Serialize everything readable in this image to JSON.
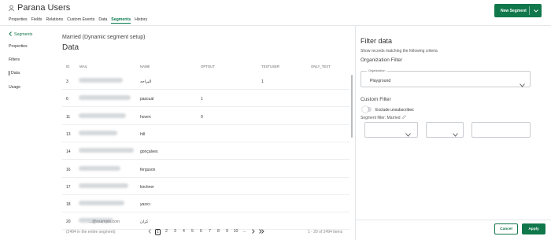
{
  "header": {
    "title": "Parana Users",
    "tabs": [
      "Properties",
      "Fields",
      "Relations",
      "Custom Events",
      "Data",
      "Segments",
      "History"
    ],
    "active_tab": "Segments",
    "new_segment_label": "New Segment"
  },
  "sidebar": {
    "back_label": "Segments",
    "items": [
      "Properties",
      "Filters",
      "Data",
      "Usage"
    ],
    "active_item": "Data"
  },
  "main": {
    "subtitle": "Married (Dynamic segment setup)",
    "heading": "Data",
    "columns": [
      "ID",
      "MAIL",
      "NAME",
      "OPTOUT",
      "TESTUSER",
      "ONLY_TEXT"
    ],
    "rows": [
      {
        "id": "3",
        "mail": "",
        "name": "اليراحه",
        "optout": "",
        "testuser": "1",
        "only_text": ""
      },
      {
        "id": "6",
        "mail": "",
        "name": "pascual",
        "optout": "1",
        "testuser": "",
        "only_text": ""
      },
      {
        "id": "11",
        "mail": "",
        "name": "hoven",
        "optout": "9",
        "testuser": "",
        "only_text": ""
      },
      {
        "id": "13",
        "mail": "",
        "name": "hill",
        "optout": "",
        "testuser": "",
        "only_text": ""
      },
      {
        "id": "14",
        "mail": "",
        "name": "gonçalves",
        "optout": "",
        "testuser": "",
        "only_text": ""
      },
      {
        "id": "16",
        "mail": "",
        "name": "ferguson",
        "optout": "",
        "testuser": "",
        "only_text": ""
      },
      {
        "id": "17",
        "mail": "",
        "name": "kirchner",
        "optout": "",
        "testuser": "",
        "only_text": ""
      },
      {
        "id": "18",
        "mail": "",
        "name": "yazıcı",
        "optout": "",
        "testuser": "",
        "only_text": ""
      },
      {
        "id": "20",
        "mail": "...@example.com",
        "name": "كران",
        "optout": "",
        "testuser": "",
        "only_text": ""
      }
    ]
  },
  "pagination": {
    "total_label": "(2494 in the entire segment)",
    "pages": [
      "1",
      "2",
      "3",
      "4",
      "5",
      "6",
      "7",
      "8",
      "9",
      "10",
      "..."
    ],
    "current_page": "1",
    "range_label": "1 - 20 of 2494 items"
  },
  "filter_panel": {
    "title": "Filter data",
    "subtitle": "Show records matching the following criteria",
    "org_section": "Organization Filter",
    "org_label": "Organization",
    "org_value": "Playground",
    "custom_section": "Custom Filter",
    "exclude_label": "Exclude unsubscribes",
    "segment_filter_label": "Segment filter: Married",
    "cancel_label": "Cancel",
    "apply_label": "Apply"
  },
  "colors": {
    "accent": "#10784b"
  },
  "icons": {
    "title": "users-icon",
    "back": "chevron-left-icon",
    "dropdown": "chevron-down-icon",
    "edit": "pencil-icon",
    "pager_prev": "chevron-left-icon",
    "pager_next": "chevron-right-icon",
    "pager_last": "double-chevron-right-icon"
  }
}
